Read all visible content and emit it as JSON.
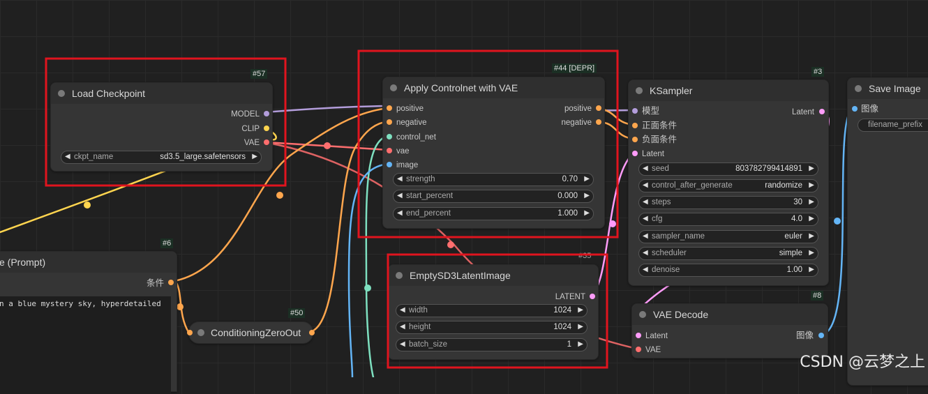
{
  "colors": {
    "model": "#b39ddb",
    "clip": "#ffd54f",
    "vae": "#ff6e6e",
    "conditioning": "#ffa64d",
    "control_net": "#7ee0c0",
    "image": "#64b5f6",
    "latent": "#ff9cf9",
    "highlight": "#e0141e"
  },
  "nodes": {
    "load_checkpoint": {
      "id": "#57",
      "title": "Load Checkpoint",
      "outputs": [
        "MODEL",
        "CLIP",
        "VAE"
      ],
      "widget": {
        "name": "ckpt_name",
        "value": "sd3.5_large.safetensors"
      }
    },
    "apply_controlnet": {
      "id": "#44 [DEPR]",
      "title": "Apply Controlnet with VAE",
      "inputs": [
        "positive",
        "negative",
        "control_net",
        "vae",
        "image"
      ],
      "outputs": [
        "positive",
        "negative"
      ],
      "widgets": [
        {
          "name": "strength",
          "value": "0.70"
        },
        {
          "name": "start_percent",
          "value": "0.000"
        },
        {
          "name": "end_percent",
          "value": "1.000"
        }
      ]
    },
    "ksampler": {
      "id": "#3",
      "title": "KSampler",
      "inputs": [
        "模型",
        "正面条件",
        "负面条件",
        "Latent"
      ],
      "output": "Latent",
      "widgets": [
        {
          "name": "seed",
          "value": "803782799414891"
        },
        {
          "name": "control_after_generate",
          "value": "randomize"
        },
        {
          "name": "steps",
          "value": "30"
        },
        {
          "name": "cfg",
          "value": "4.0"
        },
        {
          "name": "sampler_name",
          "value": "euler"
        },
        {
          "name": "scheduler",
          "value": "simple"
        },
        {
          "name": "denoise",
          "value": "1.00"
        }
      ]
    },
    "save_image": {
      "title": "Save Image",
      "input": "图像",
      "widget_label": "filename_prefix"
    },
    "clip_text": {
      "id": "#6",
      "title": "e (Prompt)",
      "output": "条件",
      "text": "n a blue mystery sky, hyperdetailed"
    },
    "conditioning_zero_out": {
      "id": "#50",
      "title": "ConditioningZeroOut"
    },
    "empty_latent": {
      "id": "#35",
      "title": "EmptySD3LatentImage",
      "output": "LATENT",
      "widgets": [
        {
          "name": "width",
          "value": "1024"
        },
        {
          "name": "height",
          "value": "1024"
        },
        {
          "name": "batch_size",
          "value": "1"
        }
      ]
    },
    "vae_decode": {
      "id": "#8",
      "title": "VAE Decode",
      "inputs": [
        "Latent",
        "VAE"
      ],
      "output": "图像"
    }
  },
  "watermark": "CSDN @云梦之上"
}
